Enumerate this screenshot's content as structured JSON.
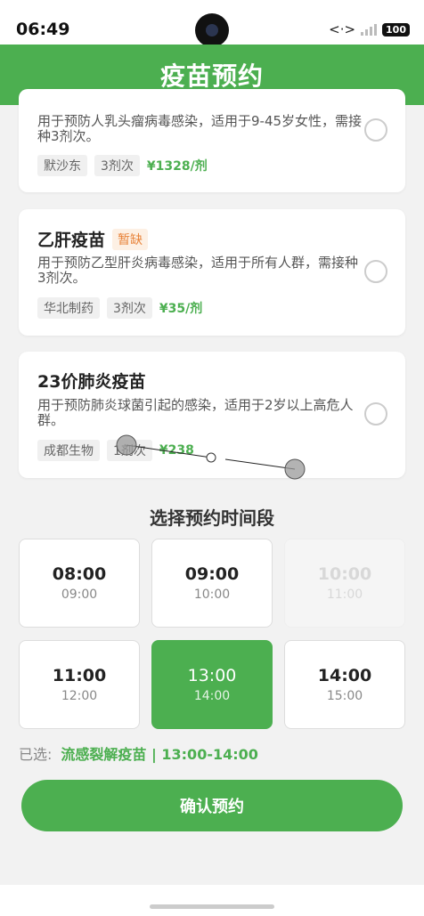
{
  "status_bar": {
    "time": "06:49",
    "network_icon": "<·>",
    "battery": "100"
  },
  "header": {
    "title": "疫苗预约"
  },
  "vaccines": [
    {
      "desc": "用于预防人乳头瘤病毒感染，适用于9-45岁女性，需接种3剂次。",
      "maker": "默沙东",
      "doses": "3剂次",
      "price": "¥1328/剂"
    },
    {
      "name": "乙肝疫苗",
      "badge": "暂缺",
      "desc": "用于预防乙型肝炎病毒感染，适用于所有人群，需接种3剂次。",
      "maker": "华北制药",
      "doses": "3剂次",
      "price": "¥35/剂"
    },
    {
      "name": "23价肺炎疫苗",
      "desc": "用于预防肺炎球菌引起的感染，适用于2岁以上高危人群。",
      "maker": "成都生物",
      "doses": "1剂次",
      "price": "¥238"
    }
  ],
  "time_section": {
    "title": "选择预约时间段"
  },
  "slots": [
    {
      "start": "08:00",
      "end": "09:00",
      "state": "available"
    },
    {
      "start": "09:00",
      "end": "10:00",
      "state": "available"
    },
    {
      "start": "10:00",
      "end": "11:00",
      "state": "disabled"
    },
    {
      "start": "11:00",
      "end": "12:00",
      "state": "available"
    },
    {
      "start": "13:00",
      "end": "14:00",
      "state": "selected"
    },
    {
      "start": "14:00",
      "end": "15:00",
      "state": "available"
    }
  ],
  "selection": {
    "label": "已选:",
    "value": "流感裂解疫苗 | 13:00-14:00"
  },
  "confirm_label": "确认预约",
  "colors": {
    "primary": "#4caf50",
    "badge": "#e8833a"
  }
}
